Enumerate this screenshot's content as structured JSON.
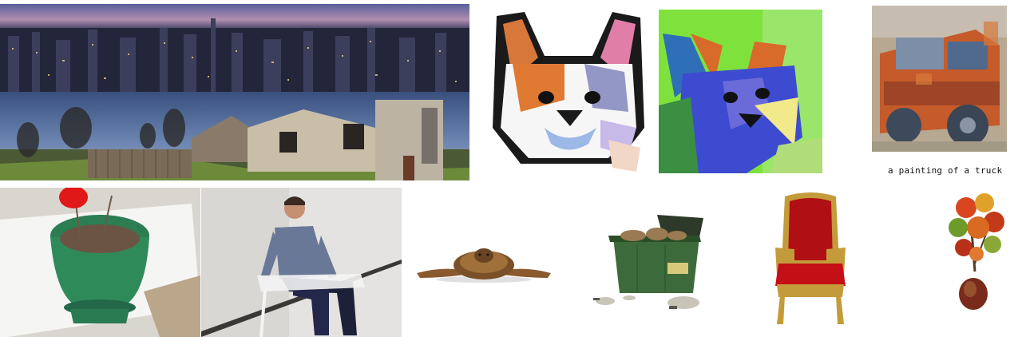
{
  "captions": {
    "truck": "a painting of a truck"
  },
  "images": [
    {
      "name": "city-night-panorama"
    },
    {
      "name": "painted-street-houses"
    },
    {
      "name": "stylized-dog-face-white"
    },
    {
      "name": "stylized-dog-face-green"
    },
    {
      "name": "painted-truck"
    },
    {
      "name": "potted-rose"
    },
    {
      "name": "man-sitting-on-chair"
    },
    {
      "name": "sea-turtle-3d"
    },
    {
      "name": "dumpster-3d"
    },
    {
      "name": "red-armchair-3d"
    },
    {
      "name": "potted-maple-tree-3d"
    }
  ]
}
